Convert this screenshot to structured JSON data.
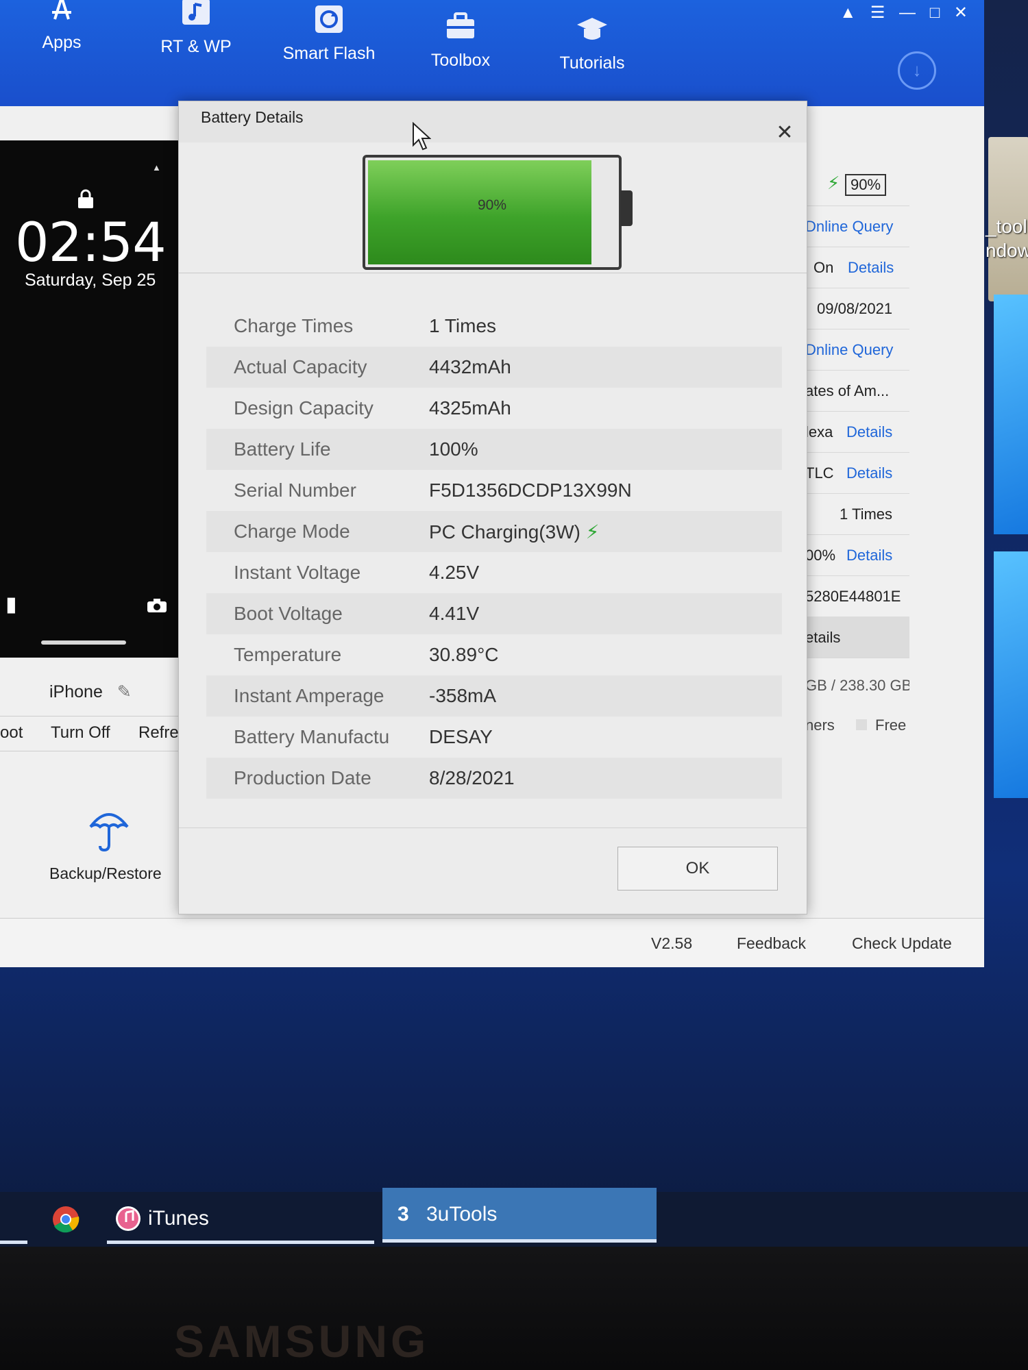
{
  "app": {
    "nav": [
      {
        "label": "Apps",
        "icon": "apps-icon"
      },
      {
        "label": "RT & WP",
        "icon": "ringtone-icon"
      },
      {
        "label": "Smart Flash",
        "icon": "smart-flash-icon"
      },
      {
        "label": "Toolbox",
        "icon": "toolbox-icon"
      },
      {
        "label": "Tutorials",
        "icon": "tutorials-icon"
      }
    ],
    "accent": "#1a56d6"
  },
  "device": {
    "time": "02:54",
    "date": "Saturday, Sep 25",
    "name": "iPhone",
    "actions": [
      "oot",
      "Turn Off",
      "Refre"
    ],
    "backup_label": "Backup/Restore"
  },
  "info_column": {
    "battery_pct": "90%",
    "rows": [
      {
        "text": "Online Query",
        "link": true,
        "display": "Dnline Query"
      },
      {
        "text": "On",
        "link_text": "Details"
      },
      {
        "text": "09/08/2021"
      },
      {
        "text": "Online Query",
        "display": "Dnline Query"
      },
      {
        "text": "ates of Am..."
      },
      {
        "text": "lexa",
        "link_text": "Details"
      },
      {
        "text": "TLC",
        "link_text": "Details"
      },
      {
        "text": "1 Times"
      },
      {
        "text": "00%",
        "link_text": "Details"
      },
      {
        "text": "5280E44801E"
      },
      {
        "text": "etails"
      }
    ],
    "storage": "GB / 238.30 GB",
    "legend_others": "ners",
    "legend_free": "Free"
  },
  "footer": {
    "version": "V2.58",
    "feedback": "Feedback",
    "check_update": "Check Update"
  },
  "modal": {
    "title": "Battery Details",
    "battery_level": 0.9,
    "battery_label": "90%",
    "rows": [
      {
        "key": "Charge Times",
        "value": "1 Times"
      },
      {
        "key": "Actual Capacity",
        "value": "4432mAh"
      },
      {
        "key": "Design Capacity",
        "value": "4325mAh"
      },
      {
        "key": "Battery Life",
        "value": "100%"
      },
      {
        "key": "Serial Number",
        "value": "F5D1356DCDP13X99N"
      },
      {
        "key": "Charge Mode",
        "value": "PC Charging(3W)"
      },
      {
        "key": "Instant Voltage",
        "value": "4.25V"
      },
      {
        "key": "Boot Voltage",
        "value": "4.41V"
      },
      {
        "key": "Temperature",
        "value": "30.89°C"
      },
      {
        "key": "Instant Amperage",
        "value": "-358mA"
      },
      {
        "key": "Battery Manufactu",
        "value": "DESAY"
      },
      {
        "key": "Production Date",
        "value": "8/28/2021"
      }
    ],
    "ok_label": "OK"
  },
  "desktop": {
    "icon_label_1": "_tool",
    "icon_label_2": "ndow"
  },
  "taskbar": {
    "items": [
      {
        "label": "",
        "icon": "chrome-icon"
      },
      {
        "label": "iTunes",
        "icon": "itunes-icon"
      },
      {
        "label": "3uTools",
        "icon": "3utools-icon"
      }
    ]
  },
  "monitor_brand": "SAMSUNG"
}
